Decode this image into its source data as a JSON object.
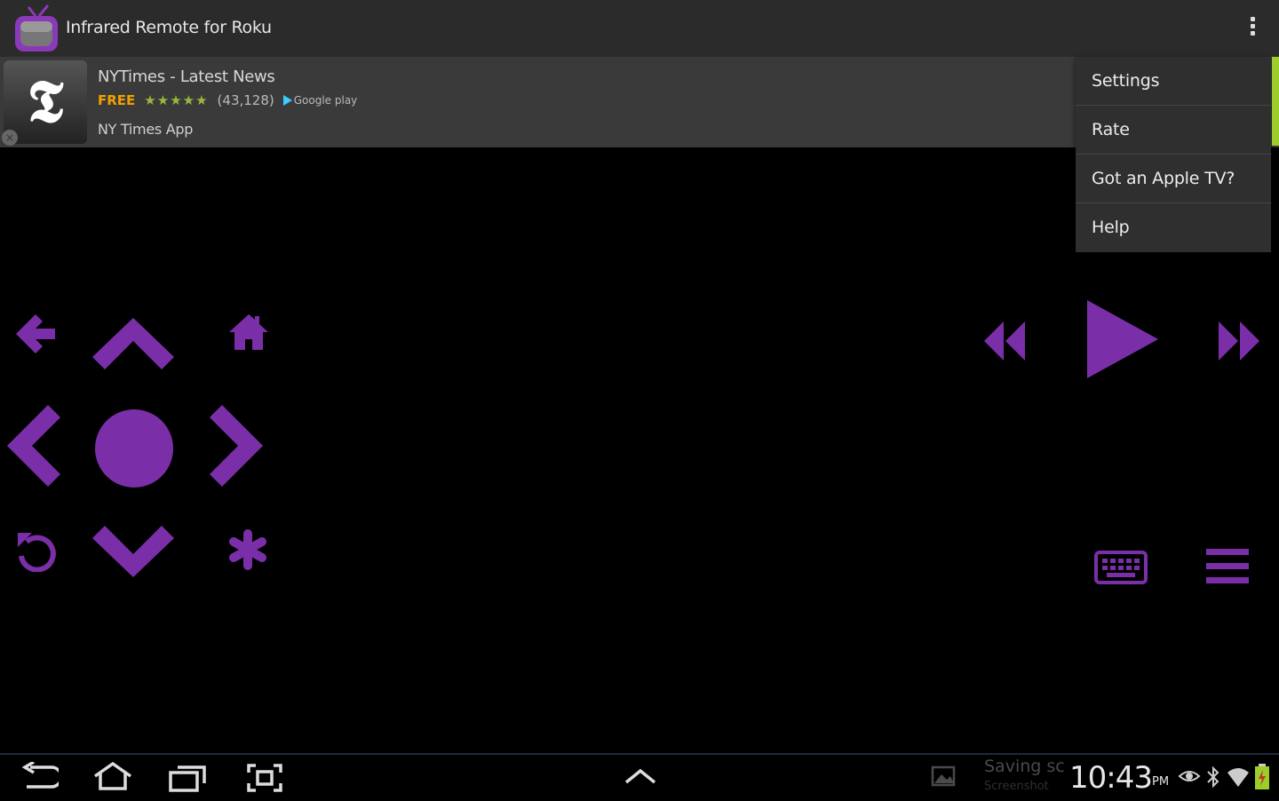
{
  "app": {
    "title": "Infrared Remote for Roku"
  },
  "ad": {
    "logo_glyph": "𝕿",
    "close_glyph": "×",
    "title": "NYTimes - Latest News",
    "price": "FREE",
    "stars": "★★★★★",
    "rating_count": "(43,128)",
    "store": "Google play",
    "subtitle": "NY Times App"
  },
  "menu": {
    "items": [
      {
        "label": "Settings"
      },
      {
        "label": "Rate"
      },
      {
        "label": "Got an Apple TV?"
      },
      {
        "label": "Help"
      }
    ]
  },
  "status": {
    "notification": "Saving sc",
    "notification_sub": "Screenshot",
    "time": "10:43",
    "ampm": "PM"
  },
  "colors": {
    "accent": "#7a2fa8",
    "actionbar": "#2b2b2b",
    "menu": "#2f2f2f",
    "scroll": "#9ccd2a"
  }
}
